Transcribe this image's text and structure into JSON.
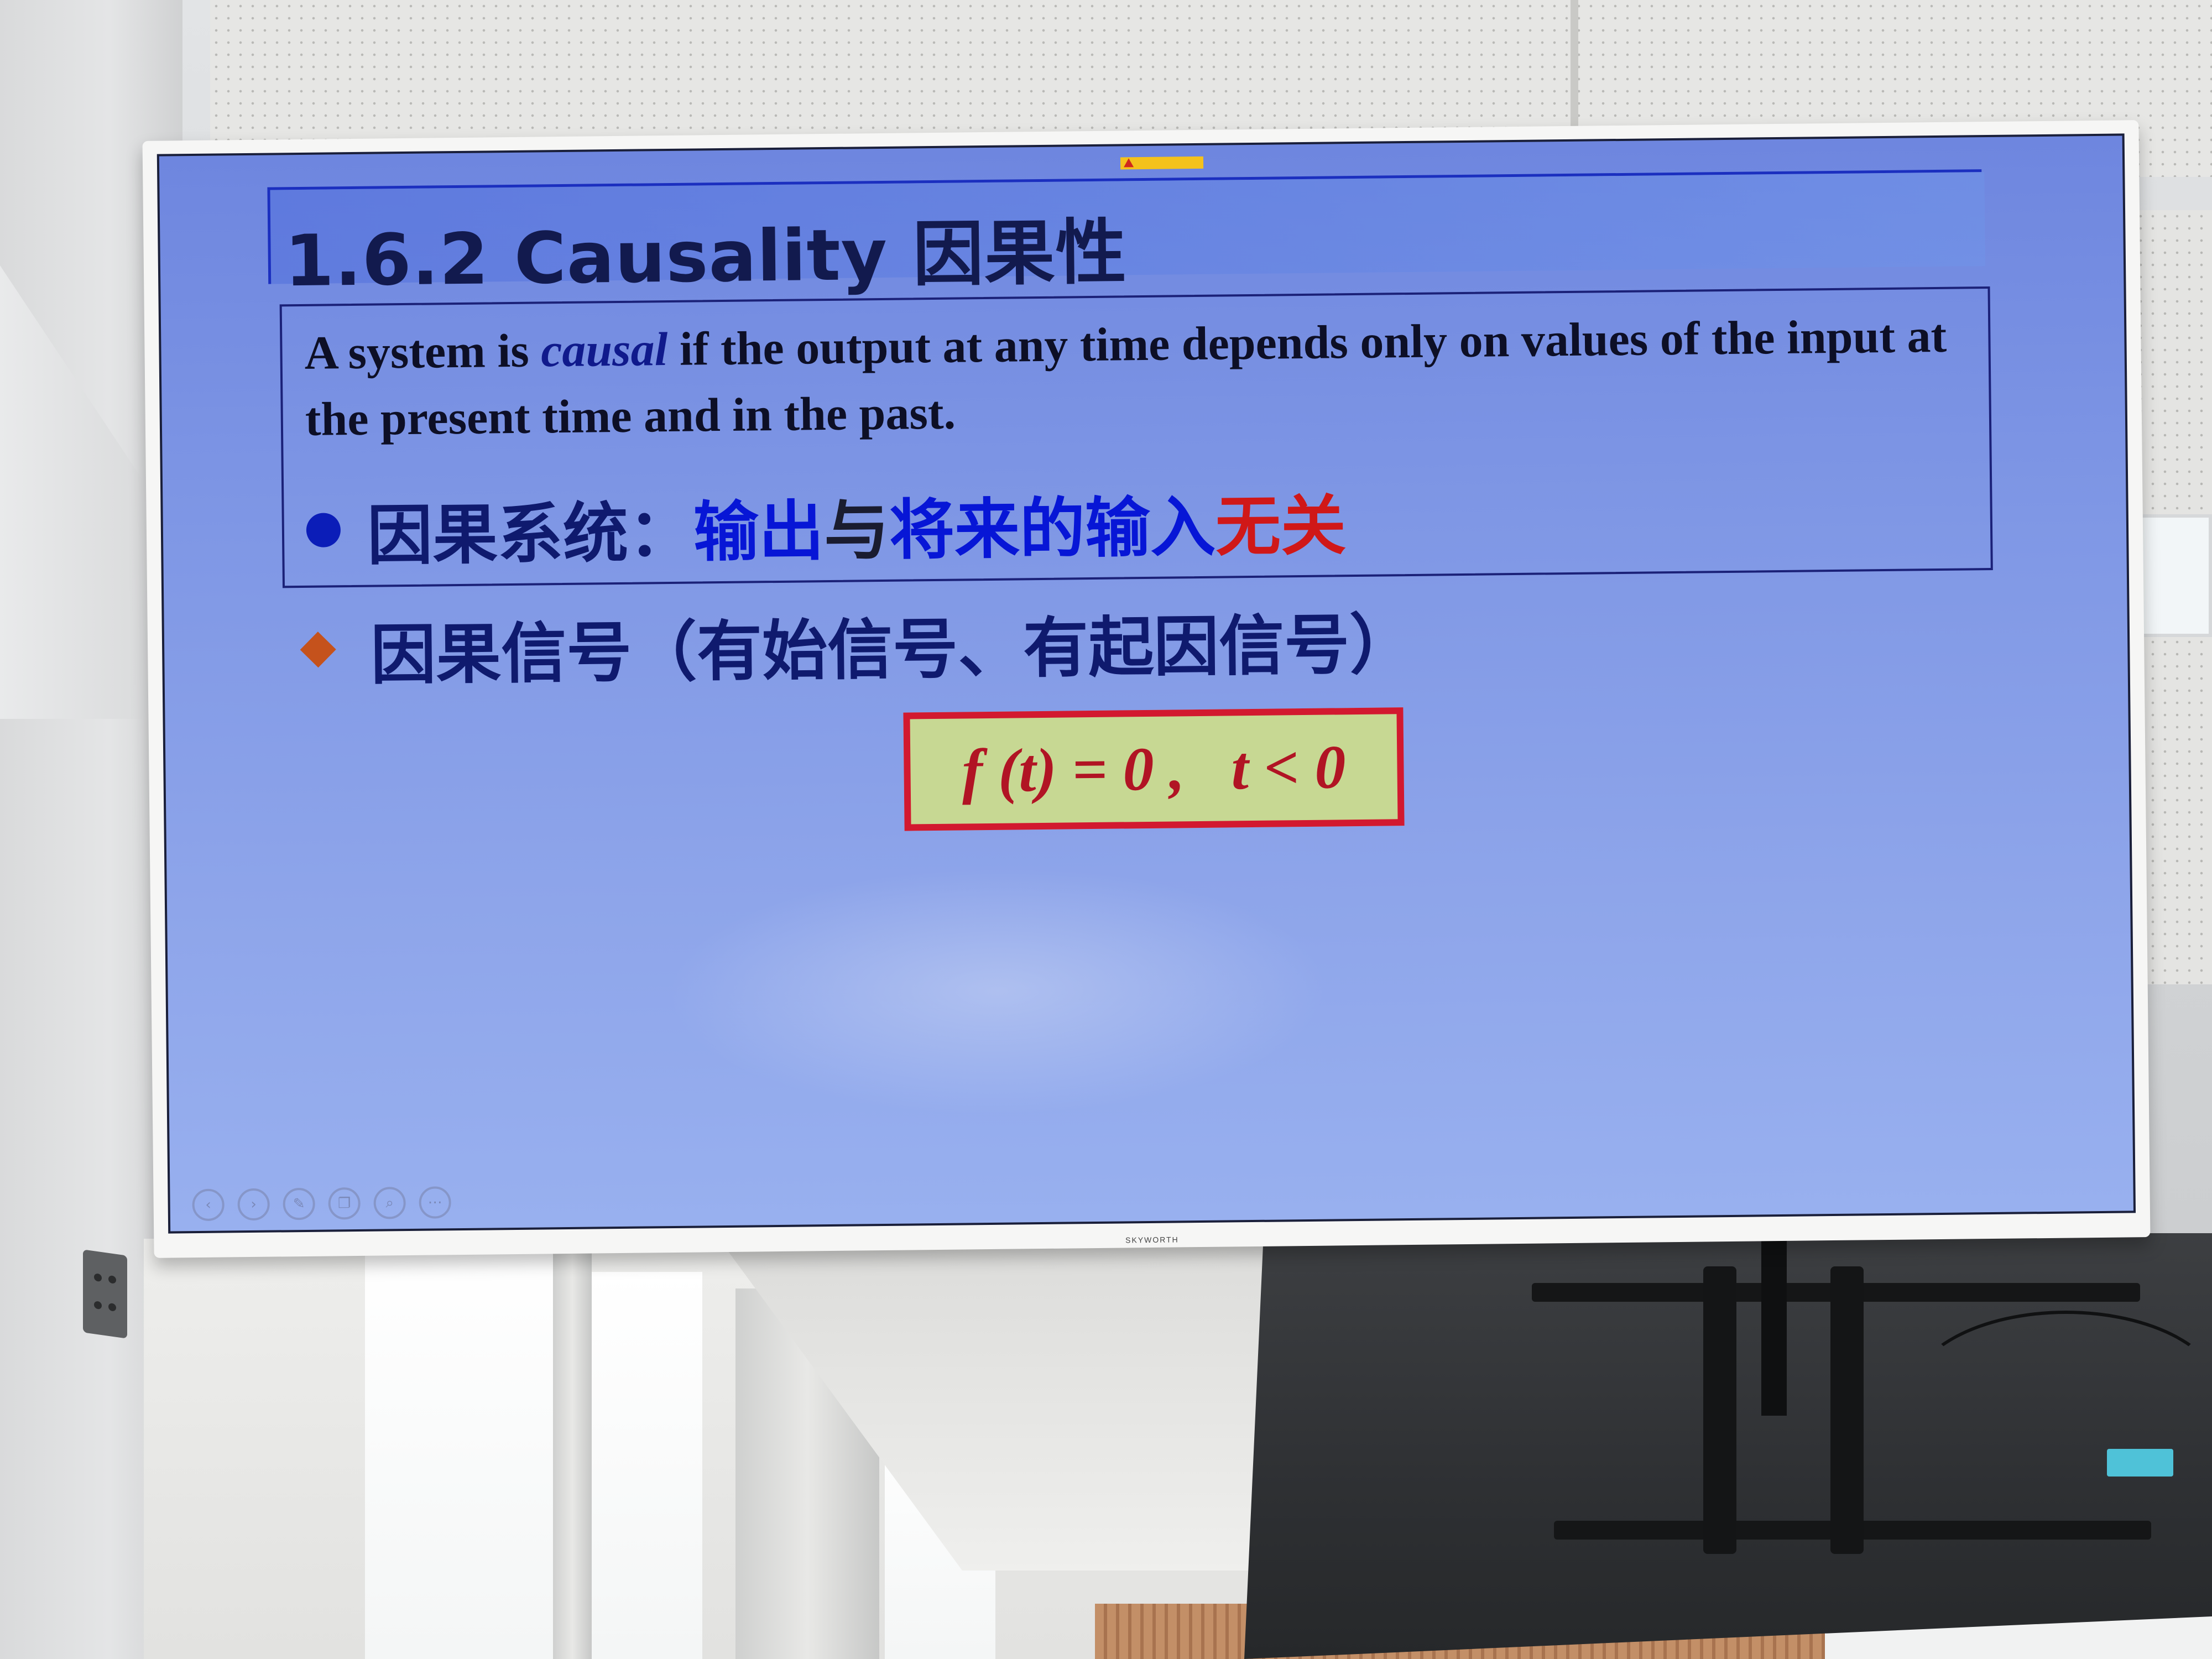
{
  "tv": {
    "brand": "SKYWORTH"
  },
  "slide": {
    "title": "1.6.2  Causality 因果性",
    "definition": {
      "part1": "A system is ",
      "emphasis": "causal",
      "part2": " if the output at any time depends only on values of the input at the present time and in the past."
    },
    "bullet": {
      "label": "因果系统：",
      "seg1": "输出",
      "seg2": "与",
      "seg3": "将来的输入",
      "seg4": "无关"
    },
    "causal_signal": "因果信号（有始信号、有起因信号）",
    "formula": "f (t) = 0 ,   t < 0"
  },
  "controls": {
    "icons": [
      "prev-icon",
      "next-icon",
      "pen-icon",
      "pages-icon",
      "zoom-icon",
      "more-icon"
    ],
    "glyphs": [
      "‹",
      "›",
      "✎",
      "❐",
      "⌕",
      "⋯"
    ]
  },
  "colors": {
    "slide_bg": "#7f97e5",
    "title_text": "#121a4e",
    "accent_blue": "#0716d6",
    "accent_red": "#d01818",
    "formula_bg": "#c7d893",
    "formula_border": "#d2192f"
  }
}
